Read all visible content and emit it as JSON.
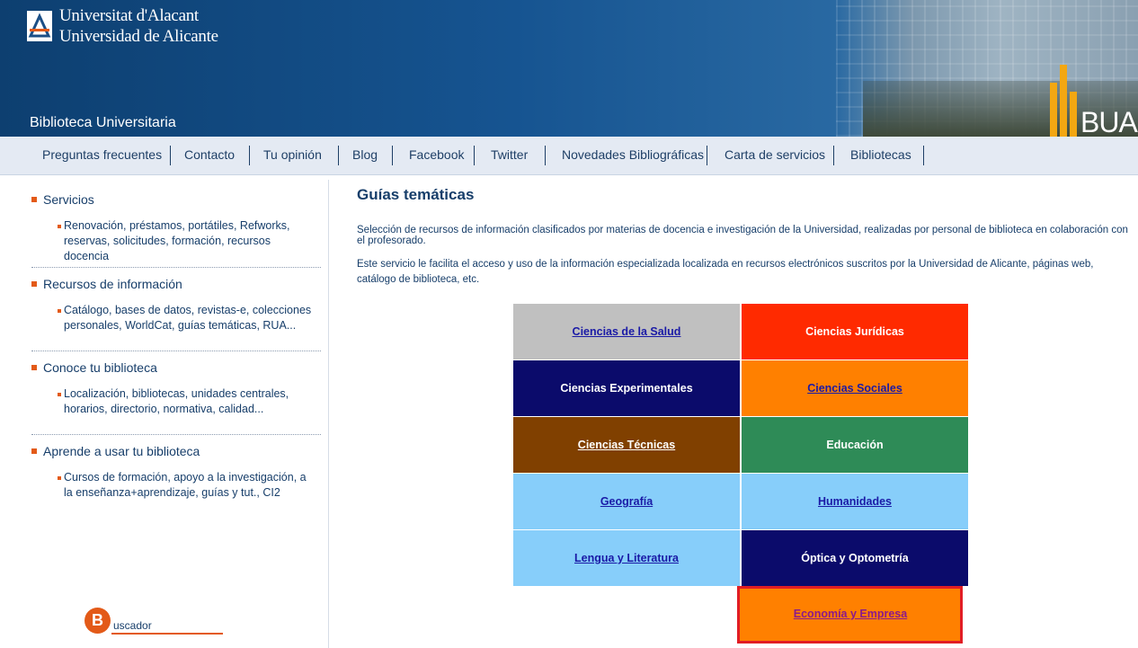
{
  "header": {
    "university_line1": "Universitat d'Alacant",
    "university_line2": "Universidad de Alicante",
    "library_title": "Biblioteca Universitaria",
    "bua_logo_text": "BUA"
  },
  "nav": {
    "items": [
      "Preguntas frecuentes",
      "Contacto",
      "Tu opinión",
      "Blog",
      "Facebook",
      "Twitter",
      "Novedades Bibliográficas",
      "Carta de servicios",
      "Bibliotecas"
    ]
  },
  "sidebar": {
    "sections": [
      {
        "title": "Servicios",
        "sub": "Renovación, préstamos, portátiles, Refworks, reservas, solicitudes, formación, recursos docencia"
      },
      {
        "title": "Recursos de información",
        "sub": "Catálogo, bases de datos, revistas-e, colecciones personales, WorldCat, guías temáticas, RUA..."
      },
      {
        "title": "Conoce tu biblioteca",
        "sub": "Localización, bibliotecas, unidades centrales, horarios, directorio, normativa, calidad..."
      },
      {
        "title": "Aprende a usar tu biblioteca",
        "sub": "Cursos de formación, apoyo a la investigación, a la enseñanza+aprendizaje, guías y tut., CI2"
      }
    ],
    "buscador_initial": "B",
    "buscador_text": "uscador"
  },
  "main": {
    "title": "Guías temáticas",
    "paragraph1": "Selección de recursos de información clasificados por materias de docencia e investigación de la Universidad, realizadas por personal de biblioteca en colaboración con el profesorado.",
    "paragraph2": "Este servicio le facilita el acceso y uso de la información especializada localizada en recursos electrónicos suscritos por la Universidad de Alicante, páginas web, catálogo de biblioteca, etc."
  },
  "guides": [
    {
      "label": "Ciencias de la Salud",
      "bg": "#c0c0c0",
      "color": "#1a1aa6",
      "underline": true
    },
    {
      "label": "Ciencias Jurídicas",
      "bg": "#ff2a00",
      "color": "#ffffff",
      "underline": false
    },
    {
      "label": "Ciencias Experimentales",
      "bg": "#0b0b6b",
      "color": "#ffffff",
      "underline": false
    },
    {
      "label": "Ciencias Sociales",
      "bg": "#ff8000",
      "color": "#1a1aa6",
      "underline": true
    },
    {
      "label": "Ciencias Técnicas",
      "bg": "#804000",
      "color": "#ffffff",
      "underline": true
    },
    {
      "label": "Educación",
      "bg": "#2e8b57",
      "color": "#ffffff",
      "underline": false
    },
    {
      "label": "Geografía",
      "bg": "#87cefa",
      "color": "#1a1aa6",
      "underline": true
    },
    {
      "label": "Humanidades",
      "bg": "#87cefa",
      "color": "#1a1aa6",
      "underline": true
    },
    {
      "label": "Lengua y Literatura",
      "bg": "#87cefa",
      "color": "#1a1aa6",
      "underline": true
    },
    {
      "label": "Óptica y Optometría",
      "bg": "#0b0b6b",
      "color": "#ffffff",
      "underline": false
    },
    {
      "label": "Economía y Empresa",
      "bg": "#ff8000",
      "color": "#8b1a8b",
      "underline": true
    }
  ]
}
